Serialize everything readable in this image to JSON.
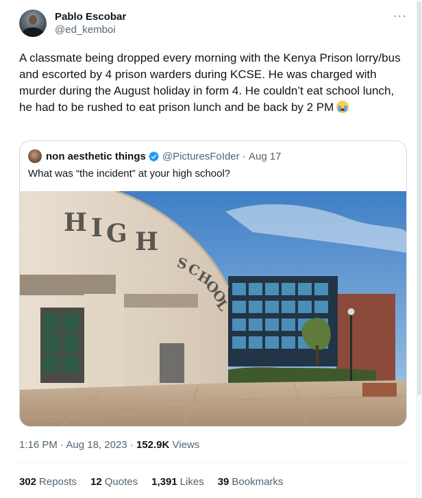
{
  "author": {
    "display_name": "Pablo Escobar",
    "handle": "@ed_kemboi"
  },
  "tweet": {
    "text": "A classmate being dropped every morning with the Kenya Prison lorry/bus and escorted by 4 prison warders during KCSE. He was charged with murder during the August holiday in form 4. He couldn’t eat school lunch, he had to be rushed to eat prison lunch and be back by 2 PM",
    "emoji": "loudly-crying-face"
  },
  "quoted_tweet": {
    "display_name": "non aesthetic things",
    "handle": "@PicturesFoIder",
    "date": "Aug 17",
    "text": "What was “the incident” at your high school?",
    "image_signs": [
      "HIGH",
      "SCHOOL"
    ]
  },
  "meta": {
    "time": "1:16 PM",
    "date": "Aug 18, 2023",
    "views_count": "152.9K",
    "views_label": "Views"
  },
  "stats": [
    {
      "count": "302",
      "label": "Reposts"
    },
    {
      "count": "12",
      "label": "Quotes"
    },
    {
      "count": "1,391",
      "label": "Likes"
    },
    {
      "count": "39",
      "label": "Bookmarks"
    }
  ],
  "colors": {
    "text": "#0f1419",
    "secondary": "#536471",
    "verified": "#1d9bf0",
    "border": "#cfd9de"
  }
}
